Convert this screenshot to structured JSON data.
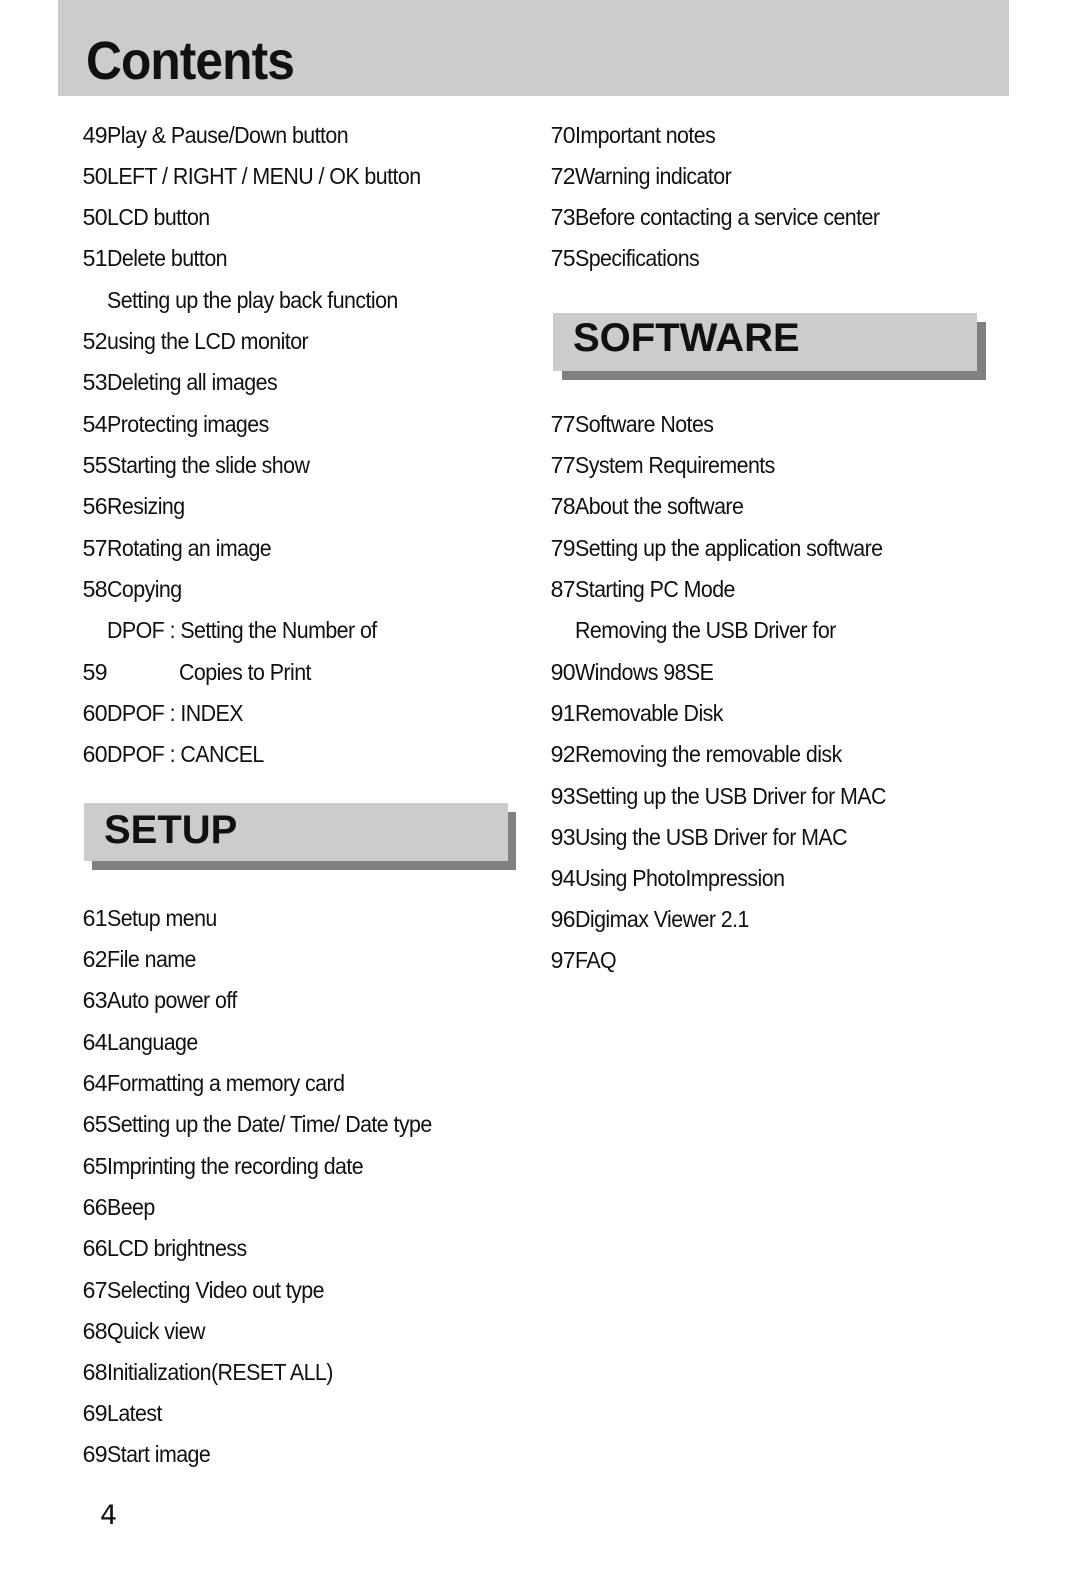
{
  "header": {
    "title": "Contents"
  },
  "left_column": {
    "top_entries": [
      {
        "label": "Play & Pause/Down button",
        "page": "49"
      },
      {
        "label": "LEFT / RIGHT / MENU / OK button",
        "page": "50"
      },
      {
        "label": "LCD button",
        "page": "50"
      },
      {
        "label": "Delete button",
        "page": "51"
      },
      {
        "label": "Setting up the play back function",
        "page": ""
      },
      {
        "label": "using the LCD monitor",
        "page": "52"
      },
      {
        "label": "Deleting all images",
        "page": "53"
      },
      {
        "label": "Protecting images",
        "page": "54"
      },
      {
        "label": "Starting the slide show",
        "page": "55"
      },
      {
        "label": "Resizing",
        "page": "56"
      },
      {
        "label": "Rotating an image",
        "page": "57"
      },
      {
        "label": "Copying",
        "page": "58"
      },
      {
        "label": "DPOF : Setting the Number of",
        "page": ""
      },
      {
        "label": "Copies to Print",
        "page": "59"
      },
      {
        "label": "DPOF : INDEX",
        "page": "60"
      },
      {
        "label": "DPOF : CANCEL",
        "page": "60"
      }
    ],
    "setup_section": {
      "title": "SETUP",
      "entries": [
        {
          "label": "Setup menu",
          "page": "61"
        },
        {
          "label": "File name",
          "page": "62"
        },
        {
          "label": "Auto power off",
          "page": "63"
        },
        {
          "label": "Language",
          "page": "64"
        },
        {
          "label": "Formatting a memory card",
          "page": "64"
        },
        {
          "label": "Setting up the Date/ Time/ Date type",
          "page": "65"
        },
        {
          "label": "Imprinting the recording date",
          "page": "65"
        },
        {
          "label": "Beep",
          "page": "66"
        },
        {
          "label": "LCD brightness",
          "page": "66"
        },
        {
          "label": "Selecting Video out type",
          "page": "67"
        },
        {
          "label": "Quick view",
          "page": "68"
        },
        {
          "label": "Initialization(RESET ALL)",
          "page": "68"
        },
        {
          "label": "Latest",
          "page": "69"
        },
        {
          "label": "Start image",
          "page": "69"
        }
      ]
    }
  },
  "right_column": {
    "top_entries": [
      {
        "label": "Important notes",
        "page": "70"
      },
      {
        "label": "Warning indicator",
        "page": "72"
      },
      {
        "label": "Before contacting a service center",
        "page": "73"
      },
      {
        "label": "Specifications",
        "page": "75"
      }
    ],
    "software_section": {
      "title": "SOFTWARE",
      "entries": [
        {
          "label": "Software Notes",
          "page": "77"
        },
        {
          "label": "System Requirements",
          "page": "77"
        },
        {
          "label": "About the software",
          "page": "78"
        },
        {
          "label": "Setting up the application software",
          "page": "79"
        },
        {
          "label": "Starting PC Mode",
          "page": "87"
        },
        {
          "label": "Removing the USB Driver for",
          "page": ""
        },
        {
          "label": "Windows 98SE",
          "page": "90"
        },
        {
          "label": "Removable Disk",
          "page": "91"
        },
        {
          "label": "Removing the removable disk",
          "page": "92"
        },
        {
          "label": "Setting up the USB Driver for MAC",
          "page": "93"
        },
        {
          "label": "Using the USB Driver for MAC",
          "page": "93"
        },
        {
          "label": "Using PhotoImpression",
          "page": "94"
        },
        {
          "label": "Digimax Viewer 2.1",
          "page": "96"
        },
        {
          "label": "FAQ",
          "page": "97"
        }
      ]
    }
  },
  "footer": {
    "page_number": "4"
  }
}
